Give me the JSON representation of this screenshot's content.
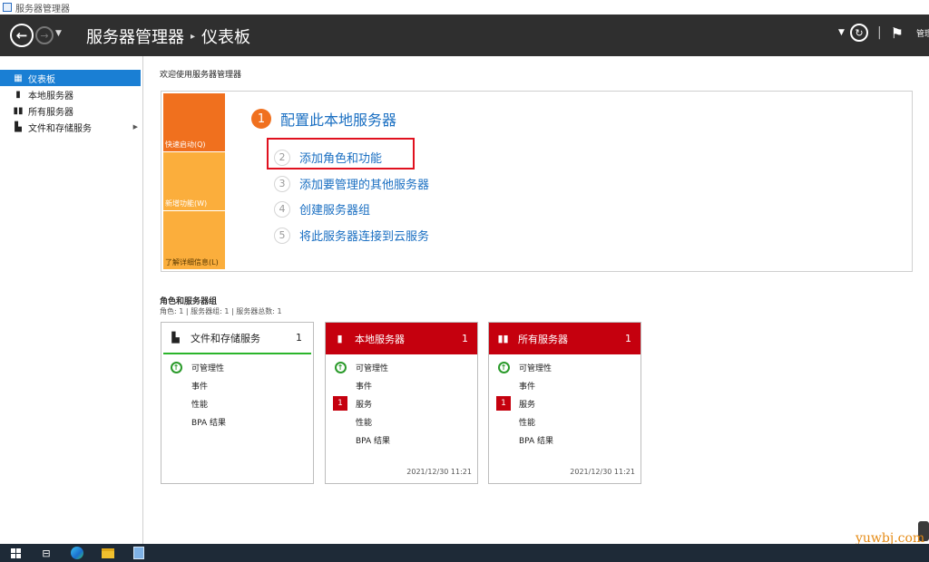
{
  "window": {
    "title": "服务器管理器"
  },
  "header": {
    "breadcrumb_root": "服务器管理器",
    "breadcrumb_sep": "▸",
    "breadcrumb_current": "仪表板",
    "menu_manage": "管理"
  },
  "sidebar": {
    "items": [
      {
        "label": "仪表板",
        "icon": "dashboard-icon",
        "active": true
      },
      {
        "label": "本地服务器",
        "icon": "server-icon"
      },
      {
        "label": "所有服务器",
        "icon": "servers-icon"
      },
      {
        "label": "文件和存储服务",
        "icon": "storage-icon",
        "has_submenu": true
      }
    ]
  },
  "main": {
    "welcome": "欢迎使用服务器管理器",
    "tiles": [
      {
        "label": "快速启动(Q)",
        "color": "#f0701e"
      },
      {
        "label": "新增功能(W)",
        "color": "#fbae3c"
      },
      {
        "label": "了解详细信息(L)",
        "color": "#fbae3c"
      }
    ],
    "steps": [
      {
        "num": "1",
        "label": "配置此本地服务器"
      },
      {
        "num": "2",
        "label": "添加角色和功能"
      },
      {
        "num": "3",
        "label": "添加要管理的其他服务器"
      },
      {
        "num": "4",
        "label": "创建服务器组"
      },
      {
        "num": "5",
        "label": "将此服务器连接到云服务"
      }
    ],
    "roles_title": "角色和服务器组",
    "roles_summary": "角色: 1 | 服务器组: 1 | 服务器总数: 1",
    "cards": [
      {
        "title": "文件和存储服务",
        "count": "1",
        "status": "ok",
        "rows": [
          "可管理性",
          "事件",
          "性能",
          "BPA 结果"
        ],
        "timestamp": ""
      },
      {
        "title": "本地服务器",
        "count": "1",
        "status": "alert",
        "rows": [
          "可管理性",
          "事件",
          "服务",
          "性能",
          "BPA 结果"
        ],
        "service_badge": "1",
        "timestamp": "2021/12/30 11:21"
      },
      {
        "title": "所有服务器",
        "count": "1",
        "status": "alert",
        "rows": [
          "可管理性",
          "事件",
          "服务",
          "性能",
          "BPA 结果"
        ],
        "service_badge": "1",
        "timestamp": "2021/12/30 11:21"
      }
    ]
  },
  "colors": {
    "accent_blue": "#1a7fd4",
    "alert_red": "#c5000e",
    "ok_green": "#2bb52b",
    "quickstart_orange": "#f0701e"
  },
  "watermark": "yuwbj.com",
  "taskbar": {
    "items": [
      "start-icon",
      "task-view-icon",
      "edge-icon",
      "file-explorer-icon",
      "server-manager-icon"
    ]
  }
}
